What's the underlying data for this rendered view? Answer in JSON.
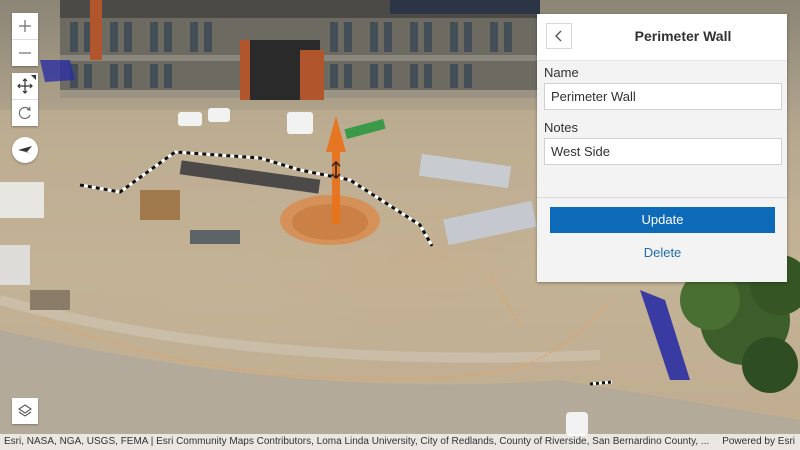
{
  "map_controls": {
    "zoom_in": "zoom-in",
    "zoom_out": "zoom-out",
    "pan": "pan",
    "rotate": "rotate",
    "compass": "compass",
    "layers": "layers"
  },
  "editor": {
    "title": "Perimeter Wall",
    "back_icon": "chevron-left-icon",
    "fields": {
      "name": {
        "label": "Name",
        "value": "Perimeter Wall"
      },
      "notes": {
        "label": "Notes",
        "value": "West Side"
      }
    },
    "update_label": "Update",
    "delete_label": "Delete",
    "accent_color": "#0d6ab8"
  },
  "manipulator": {
    "color": "#e8731c",
    "icon": "vertical-move-arrow"
  },
  "attribution": {
    "sources": "Esri, NASA, NGA, USGS, FEMA | Esri Community Maps Contributors, Loma Linda University, City of Redlands, County of Riverside, San Bernardino County, ...",
    "powered_by": "Powered by Esri"
  }
}
